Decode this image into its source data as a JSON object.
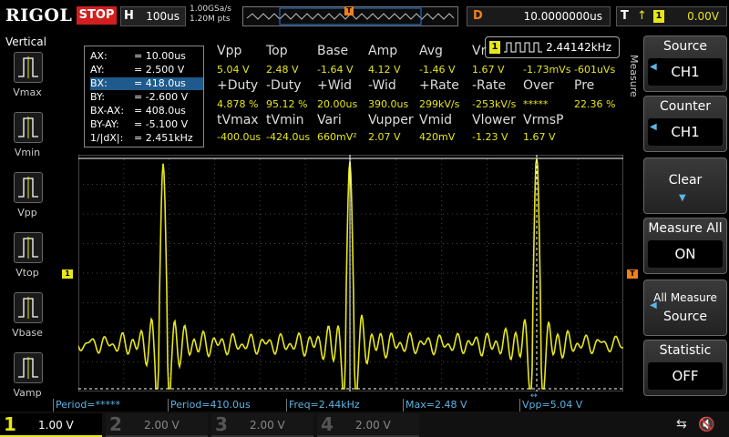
{
  "top_bar": {
    "logo": "RIGOL",
    "run_state": "STOP",
    "horizontal": {
      "label": "H",
      "value": "100us"
    },
    "sample_rate": "1.00GSa/s",
    "memory_depth": "1.20M pts",
    "trigger_marker": "T",
    "delay": {
      "label": "D",
      "value": "10.0000000us"
    },
    "trigger": {
      "label": "T",
      "edge": "↑",
      "source": "1",
      "level": "0.00V"
    }
  },
  "left_panel": {
    "title": "Vertical",
    "items": [
      {
        "label": "Vmax",
        "icon": "vmax-icon"
      },
      {
        "label": "Vmin",
        "icon": "vmin-icon"
      },
      {
        "label": "Vpp",
        "icon": "vpp-icon"
      },
      {
        "label": "Vtop",
        "icon": "vtop-icon"
      },
      {
        "label": "Vbase",
        "icon": "vbase-icon"
      },
      {
        "label": "Vamp",
        "icon": "vamp-icon"
      }
    ]
  },
  "cursor_readout": [
    {
      "key": "AX:",
      "value": "= 10.00us",
      "highlight": false
    },
    {
      "key": "AY:",
      "value": "= 2.500 V",
      "highlight": false
    },
    {
      "key": "BX:",
      "value": "= 418.0us",
      "highlight": true
    },
    {
      "key": "BY:",
      "value": "= -2.600 V",
      "highlight": false
    },
    {
      "key": "BX-AX:",
      "value": "= 408.0us",
      "highlight": false
    },
    {
      "key": "BY-AY:",
      "value": "= -5.100 V",
      "highlight": false
    },
    {
      "key": "1/|dX|:",
      "value": "= 2.451kHz",
      "highlight": false
    }
  ],
  "measurements": {
    "row1_headers": [
      "Vpp",
      "Top",
      "Base",
      "Amp",
      "Avg",
      "Vr"
    ],
    "row1_values": [
      "5.04 V",
      "2.48 V",
      "-1.64 V",
      "4.12 V",
      "-1.46 V",
      "1.67 V",
      "-1.73mVs",
      "-601uVs"
    ],
    "row2_headers": [
      "+Duty",
      "-Duty",
      "+Wid",
      "-Wid",
      "+Rate",
      "-Rate",
      "Over",
      "Pre"
    ],
    "row2_values": [
      "4.878 %",
      "95.12 %",
      "20.00us",
      "390.0us",
      "299kV/s",
      "-253kV/s",
      "*****",
      "22.36 %"
    ],
    "row3_headers": [
      "tVmax",
      "tVmin",
      "Vari",
      "Vupper",
      "Vmid",
      "Vlower",
      "VrmsP"
    ],
    "row3_values": [
      "-400.0us",
      "-424.0us",
      "660mV²",
      "2.07 V",
      "420mV",
      "-1.23 V",
      "1.67 V"
    ],
    "freq_channel": "1",
    "freq_value": "2.44142kHz"
  },
  "right_menu": {
    "section": "Measure",
    "source": {
      "title": "Source",
      "value": "CH1"
    },
    "counter": {
      "title": "Counter",
      "value": "CH1"
    },
    "clear": {
      "title": "Clear"
    },
    "measure_all": {
      "title": "Measure All",
      "value": "ON"
    },
    "all_measure_source": {
      "title1": "All Measure",
      "title2": "Source"
    },
    "statistic": {
      "title": "Statistic",
      "value": "OFF"
    }
  },
  "stats_bar": [
    "Period=*****",
    "Period=410.0us",
    "Freq=2.44kHz",
    "Max=2.48 V",
    "Vpp=5.04 V"
  ],
  "channels": [
    {
      "num": "1",
      "value": "1.00 V",
      "color": "#e6e61a",
      "active": true
    },
    {
      "num": "2",
      "value": "2.00 V",
      "color": "#2ec8d6",
      "active": false
    },
    {
      "num": "3",
      "value": "2.00 V",
      "color": "#d632c8",
      "active": false
    },
    {
      "num": "4",
      "value": "2.00 V",
      "color": "#2e6ad6",
      "active": false
    }
  ],
  "markers": {
    "ch1": "1",
    "trig_level": "T"
  }
}
